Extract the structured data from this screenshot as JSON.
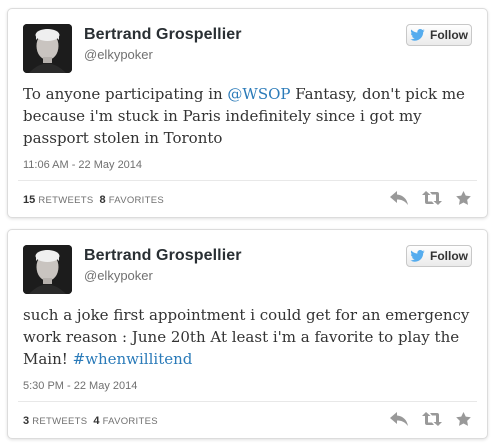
{
  "colors": {
    "link": "#2b7bb9",
    "twitter_bird": "#55acee",
    "action_icons": "#999999"
  },
  "tweets": [
    {
      "author_name": "Bertrand Grospellier",
      "handle": "@elkypoker",
      "follow_label": "Follow",
      "text_pre": "To anyone participating in ",
      "mention": "@WSOP",
      "text_post": " Fantasy, don't pick me because i'm stuck in Paris indefinitely since i got my passport stolen in Toronto",
      "timestamp": "11:06 AM - 22 May 2014",
      "retweets_count": "15",
      "retweets_label": "RETWEETS",
      "favorites_count": "8",
      "favorites_label": "FAVORITES",
      "icons": [
        "reply-icon",
        "retweet-icon",
        "favorite-icon"
      ]
    },
    {
      "author_name": "Bertrand Grospellier",
      "handle": "@elkypoker",
      "follow_label": "Follow",
      "text_pre": "such a joke first appointment i could get for an emergency work reason : June 20th At least i'm a favorite to play the Main!  ",
      "hashtag": "#whenwillitend",
      "timestamp": "5:30 PM - 22 May 2014",
      "retweets_count": "3",
      "retweets_label": "RETWEETS",
      "favorites_count": "4",
      "favorites_label": "FAVORITES",
      "icons": [
        "reply-icon",
        "retweet-icon",
        "favorite-icon"
      ]
    }
  ]
}
